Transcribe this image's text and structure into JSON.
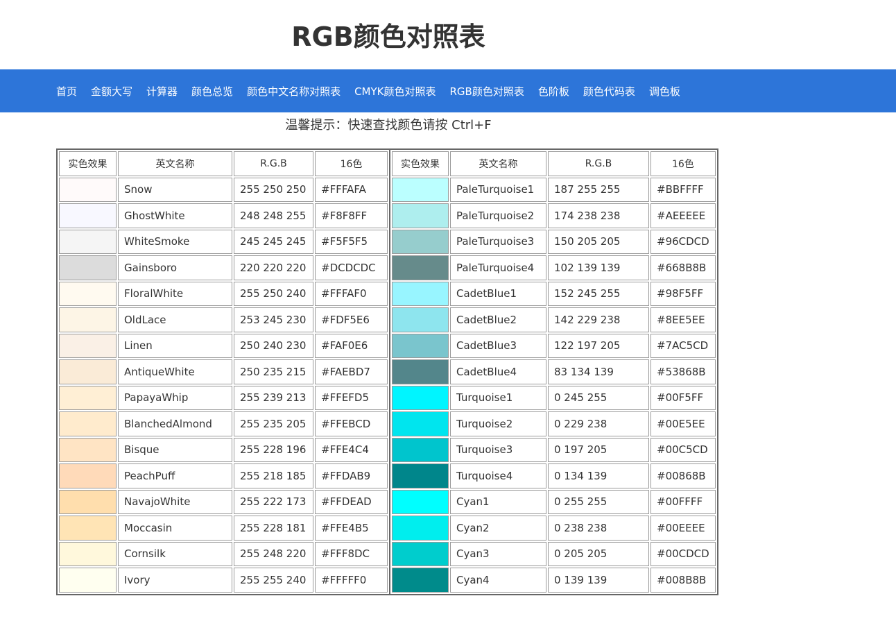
{
  "page": {
    "title": "RGB颜色对照表",
    "tip": "温馨提示：快速查找颜色请按 Ctrl+F"
  },
  "nav": {
    "items": [
      "首页",
      "金额大写",
      "计算器",
      "颜色总览",
      "颜色中文名称对照表",
      "CMYK颜色对照表",
      "RGB颜色对照表",
      "色阶板",
      "颜色代码表",
      "调色板"
    ]
  },
  "table": {
    "headers": [
      "实色效果",
      "英文名称",
      "R.G.B",
      "16色"
    ],
    "left_rows": [
      {
        "name": "Snow",
        "rgb": "255 250 250",
        "hex": "#FFFAFA"
      },
      {
        "name": "GhostWhite",
        "rgb": "248 248 255",
        "hex": "#F8F8FF"
      },
      {
        "name": "WhiteSmoke",
        "rgb": "245 245 245",
        "hex": "#F5F5F5"
      },
      {
        "name": "Gainsboro",
        "rgb": "220 220 220",
        "hex": "#DCDCDC"
      },
      {
        "name": "FloralWhite",
        "rgb": "255 250 240",
        "hex": "#FFFAF0"
      },
      {
        "name": "OldLace",
        "rgb": "253 245 230",
        "hex": "#FDF5E6"
      },
      {
        "name": "Linen",
        "rgb": "250 240 230",
        "hex": "#FAF0E6"
      },
      {
        "name": "AntiqueWhite",
        "rgb": "250 235 215",
        "hex": "#FAEBD7"
      },
      {
        "name": "PapayaWhip",
        "rgb": "255 239 213",
        "hex": "#FFEFD5"
      },
      {
        "name": "BlanchedAlmond",
        "rgb": "255 235 205",
        "hex": "#FFEBCD"
      },
      {
        "name": "Bisque",
        "rgb": "255 228 196",
        "hex": "#FFE4C4"
      },
      {
        "name": "PeachPuff",
        "rgb": "255 218 185",
        "hex": "#FFDAB9"
      },
      {
        "name": "NavajoWhite",
        "rgb": "255 222 173",
        "hex": "#FFDEAD"
      },
      {
        "name": "Moccasin",
        "rgb": "255 228 181",
        "hex": "#FFE4B5"
      },
      {
        "name": "Cornsilk",
        "rgb": "255 248 220",
        "hex": "#FFF8DC"
      },
      {
        "name": "Ivory",
        "rgb": "255 255 240",
        "hex": "#FFFFF0"
      }
    ],
    "right_rows": [
      {
        "name": "PaleTurquoise1",
        "rgb": "187 255 255",
        "hex": "#BBFFFF"
      },
      {
        "name": "PaleTurquoise2",
        "rgb": "174 238 238",
        "hex": "#AEEEEE"
      },
      {
        "name": "PaleTurquoise3",
        "rgb": "150 205 205",
        "hex": "#96CDCD"
      },
      {
        "name": "PaleTurquoise4",
        "rgb": "102 139 139",
        "hex": "#668B8B"
      },
      {
        "name": "CadetBlue1",
        "rgb": "152 245 255",
        "hex": "#98F5FF"
      },
      {
        "name": "CadetBlue2",
        "rgb": "142 229 238",
        "hex": "#8EE5EE"
      },
      {
        "name": "CadetBlue3",
        "rgb": "122 197 205",
        "hex": "#7AC5CD"
      },
      {
        "name": "CadetBlue4",
        "rgb": "83 134 139",
        "hex": "#53868B"
      },
      {
        "name": "Turquoise1",
        "rgb": "0 245 255",
        "hex": "#00F5FF"
      },
      {
        "name": "Turquoise2",
        "rgb": "0 229 238",
        "hex": "#00E5EE"
      },
      {
        "name": "Turquoise3",
        "rgb": "0 197 205",
        "hex": "#00C5CD"
      },
      {
        "name": "Turquoise4",
        "rgb": "0 134 139",
        "hex": "#00868B"
      },
      {
        "name": "Cyan1",
        "rgb": "0 255 255",
        "hex": "#00FFFF"
      },
      {
        "name": "Cyan2",
        "rgb": "0 238 238",
        "hex": "#00EEEE"
      },
      {
        "name": "Cyan3",
        "rgb": "0 205 205",
        "hex": "#00CDCD"
      },
      {
        "name": "Cyan4",
        "rgb": "0 139 139",
        "hex": "#008B8B"
      }
    ]
  },
  "colors": {
    "nav_background": "#2d75d9",
    "nav_text": "#ffffff",
    "table_border": "#999999"
  }
}
